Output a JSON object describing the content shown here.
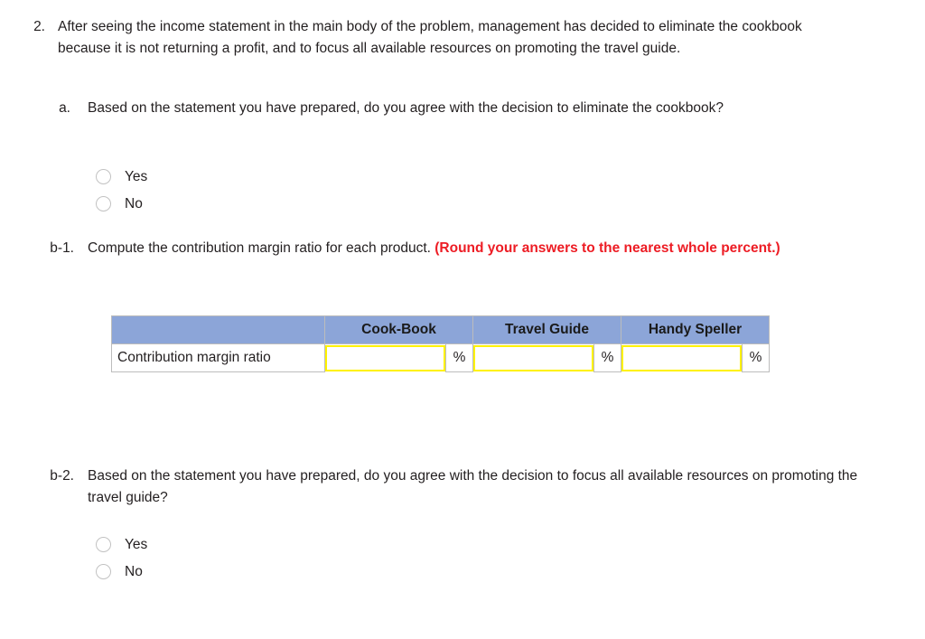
{
  "questions": {
    "q2": {
      "number": "2.",
      "text": "After seeing the income statement in the main body of the problem, management has decided to eliminate the cookbook because it is not returning a profit, and to focus all available resources on promoting the travel guide."
    },
    "qa": {
      "number": "a.",
      "text": "Based on the statement you have prepared, do you agree with the decision to eliminate the cookbook?"
    },
    "qb1": {
      "number": "b-1.",
      "text": "Compute the contribution margin ratio for each product. ",
      "emphasis": "(Round your answers to the nearest whole percent.)"
    },
    "qb2": {
      "number": "b-2.",
      "text": "Based on the statement you have prepared, do you agree with the decision to focus all available resources on promoting the travel guide?"
    }
  },
  "radio_options": {
    "yes": "Yes",
    "no": "No"
  },
  "table": {
    "blank_header": "",
    "headers": [
      "Cook-Book",
      "Travel Guide",
      "Handy Speller"
    ],
    "row_label": "Contribution margin ratio",
    "unit": "%",
    "values": [
      "",
      "",
      ""
    ],
    "placeholder": ""
  },
  "colors": {
    "header_blue": "#8ca5d8",
    "input_yellow": "#fff200",
    "emphasis_red": "#ed1c24",
    "text": "#231f20",
    "border_gray": "#bcbcbc",
    "radio_border": "#c2c2c2"
  }
}
